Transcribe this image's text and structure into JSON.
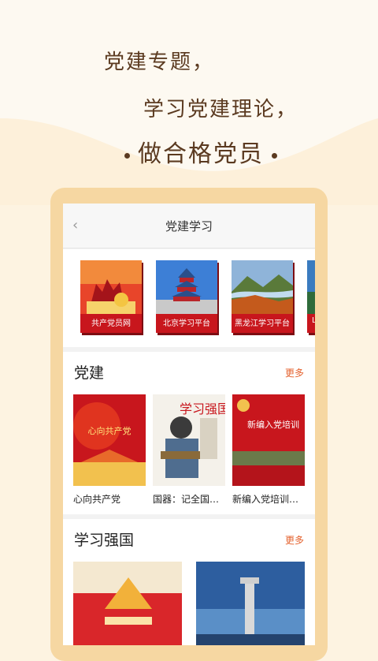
{
  "slogan": {
    "line1": "党建专题，",
    "line2": "学习党建理论，",
    "line3": "做合格党员"
  },
  "nav": {
    "title": "党建学习"
  },
  "platforms": [
    {
      "label": "共产党员网",
      "icon": "party-monument-image"
    },
    {
      "label": "北京学习平台",
      "icon": "temple-of-heaven-image"
    },
    {
      "label": "黑龙江学习平台",
      "icon": "autumn-mountains-image"
    }
  ],
  "sections": [
    {
      "title": "党建",
      "more": "更多",
      "books": [
        {
          "title": "心向共产党",
          "cover_text": "心向共产党"
        },
        {
          "title": "国器：记全国…",
          "cover_text": "国器"
        },
        {
          "title": "新编入党培训…",
          "cover_text": "新编入党培训"
        }
      ]
    },
    {
      "title": "学习强国",
      "more": "更多"
    }
  ],
  "colors": {
    "accent": "#c8161d",
    "more": "#e4612d",
    "slogan": "#5b3a20",
    "frame": "#f6d7a2"
  }
}
